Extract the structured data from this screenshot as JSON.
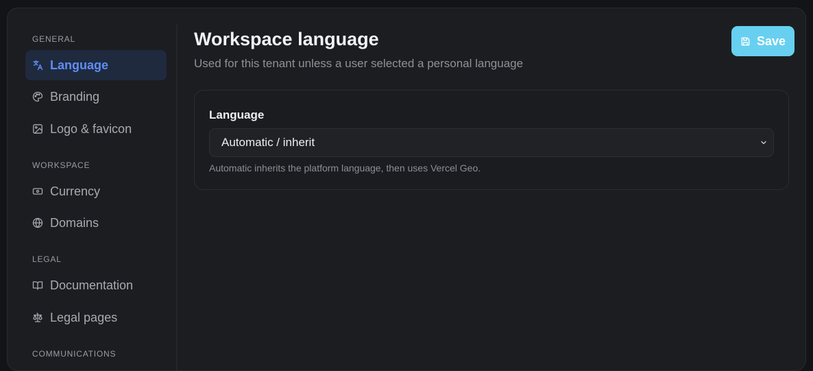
{
  "sidebar": {
    "sections": [
      {
        "title": "GENERAL",
        "items": [
          {
            "label": "Language",
            "icon": "translate-icon",
            "active": true
          },
          {
            "label": "Branding",
            "icon": "palette-icon",
            "active": false
          },
          {
            "label": "Logo & favicon",
            "icon": "image-icon",
            "active": false
          }
        ]
      },
      {
        "title": "WORKSPACE",
        "items": [
          {
            "label": "Currency",
            "icon": "banknote-icon",
            "active": false
          },
          {
            "label": "Domains",
            "icon": "globe-icon",
            "active": false
          }
        ]
      },
      {
        "title": "LEGAL",
        "items": [
          {
            "label": "Documentation",
            "icon": "book-icon",
            "active": false
          },
          {
            "label": "Legal pages",
            "icon": "scale-icon",
            "active": false
          }
        ]
      },
      {
        "title": "COMMUNICATIONS",
        "items": []
      }
    ]
  },
  "header": {
    "title": "Workspace language",
    "subtitle": "Used for this tenant unless a user selected a personal language",
    "save_label": "Save"
  },
  "language_panel": {
    "label": "Language",
    "selected_value": "Automatic / inherit",
    "help_text": "Automatic inherits the platform language, then uses Vercel Geo."
  },
  "colors": {
    "accent": "#5f8df5",
    "save_button": "#67d0f0",
    "background": "#1c1d21"
  }
}
